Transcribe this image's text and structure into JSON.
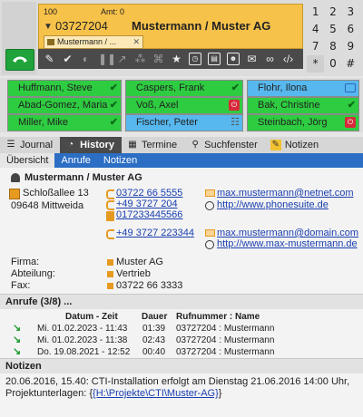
{
  "call": {
    "id": "100",
    "amt": "Amt: 0",
    "number": "03727204",
    "name": "Mustermann  /  Muster AG",
    "tab_label": "Mustermann / ...",
    "toolbar_icons": [
      "pencil-icon",
      "check-icon",
      "record-icon",
      "pause-icon",
      "transfer-icon",
      "conference-icon",
      "network-icon",
      "star-icon",
      "clock-icon",
      "contact-card-icon",
      "person-icon",
      "mail-icon",
      "link-icon",
      "code-icon"
    ]
  },
  "dialpad": [
    "1",
    "2",
    "3",
    "4",
    "5",
    "6",
    "7",
    "8",
    "9",
    "*",
    "0",
    "#"
  ],
  "contacts": [
    {
      "name": "Huffmann, Steve",
      "color": "#2ecc40",
      "status": "ok"
    },
    {
      "name": "Caspers, Frank",
      "color": "#2ecc40",
      "status": "ok"
    },
    {
      "name": "Flohr, Ilona",
      "color": "#56b8ee",
      "status": "bag"
    },
    {
      "name": "Abad-Gomez, Maria",
      "color": "#2ecc40",
      "status": "ok"
    },
    {
      "name": "Voß, Axel",
      "color": "#2ecc40",
      "status": "red"
    },
    {
      "name": "Bak, Christine",
      "color": "#2ecc40",
      "status": "ok"
    },
    {
      "name": "Miller, Mike",
      "color": "#2ecc40",
      "status": "ok"
    },
    {
      "name": "Fischer, Peter",
      "color": "#56b8ee",
      "status": "grp"
    },
    {
      "name": "Steinbach, Jörg",
      "color": "#2ecc40",
      "status": "red"
    }
  ],
  "tabs": [
    "Journal",
    "History",
    "Termine",
    "Suchfenster",
    "Notizen"
  ],
  "subtabs": [
    "Übersicht",
    "Anrufe",
    "Notizen"
  ],
  "contact": {
    "title": "Mustermann / Muster AG",
    "street": "Schloßallee 13",
    "city": "09648 Mittweida",
    "phones": [
      "03722 66 5555",
      "+49 3727 204",
      "017233445566",
      "+49 3727 223344"
    ],
    "emails": [
      "max.mustermann@netnet.com",
      "max.mustermann@domain.com"
    ],
    "webs": [
      "http://www.phonesuite.de",
      "http://www.max-mustermann.de"
    ],
    "firma_label": "Firma:",
    "firma": "Muster AG",
    "abteilung_label": "Abteilung:",
    "abteilung": "Vertrieb",
    "fax_label": "Fax:",
    "fax": "03722 66 3333"
  },
  "calls": {
    "title": "Anrufe (3/8) ...",
    "headers": [
      "Datum - Zeit",
      "Dauer",
      "Rufnummer : Name"
    ],
    "rows": [
      [
        "Mi. 01.02.2023 - 11:43",
        "01:39",
        "03727204 : Mustermann"
      ],
      [
        "Mi. 01.02.2023 - 11:38",
        "02:43",
        "03727204 : Mustermann"
      ],
      [
        "Do. 19.08.2021 - 12:52",
        "00:40",
        "03727204 : Mustermann"
      ]
    ]
  },
  "notes": {
    "title": "Notizen",
    "line1": "20.06.2016, 15.40: CTI-Installation erfolgt am Dienstag 21.06.2016 14:00 Uhr,",
    "line2_prefix": "Projektunterlagen: {",
    "line2_link": "{H:\\Projekte\\CTI\\Muster-AG}",
    "line2_suffix": "}"
  }
}
